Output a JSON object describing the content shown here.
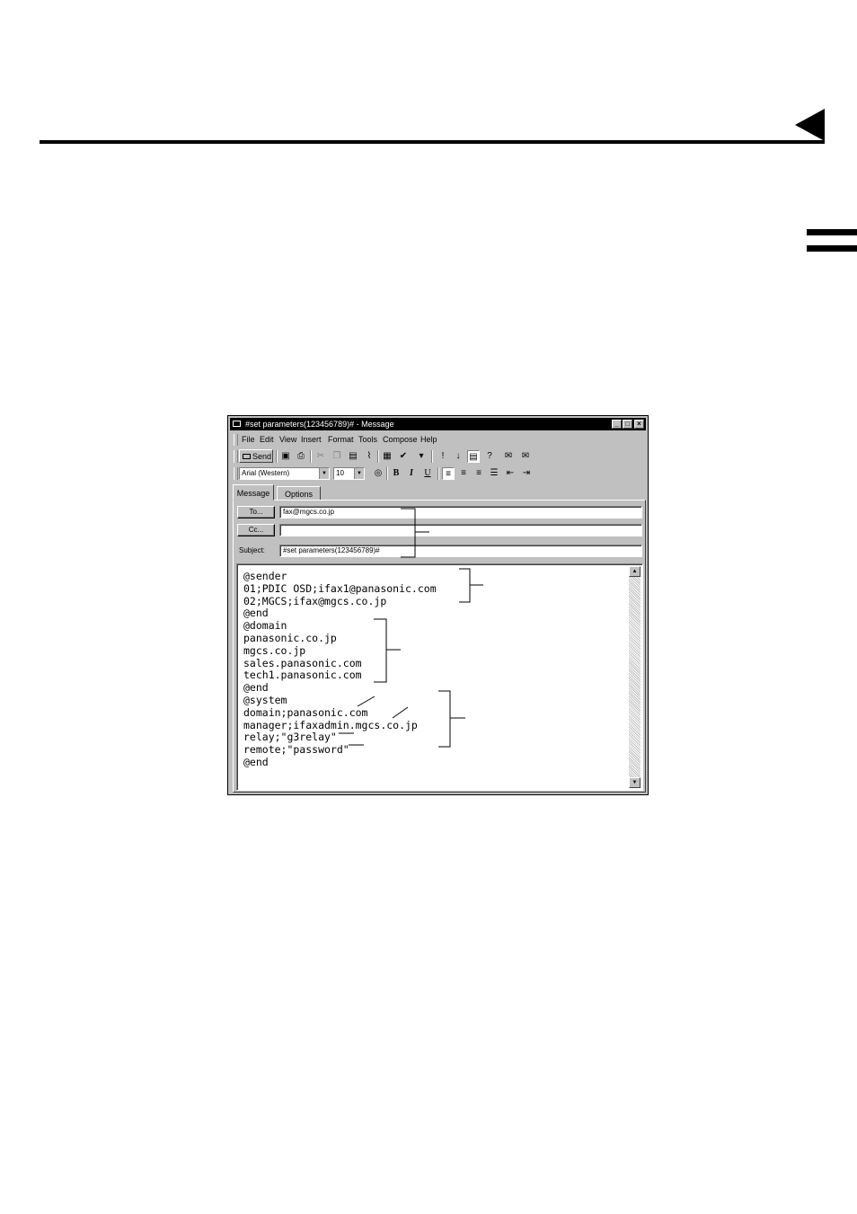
{
  "window": {
    "title": "#set parameters(123456789)# - Message",
    "controls": {
      "minimize": "_",
      "maximize": "□",
      "close": "×"
    }
  },
  "menubar": {
    "items": [
      "File",
      "Edit",
      "View",
      "Insert",
      "Format",
      "Tools",
      "Compose",
      "Help"
    ]
  },
  "toolbar": {
    "send_label": "Send"
  },
  "format_bar": {
    "font": "Arial (Western)",
    "size": "10",
    "bold": "B",
    "italic": "I",
    "underline": "U"
  },
  "tabs": [
    "Message",
    "Options"
  ],
  "header": {
    "to_button": "To...",
    "cc_button": "Cc...",
    "subject_label": "Subject:",
    "to_value": "fax@mgcs.co.jp",
    "cc_value": "",
    "subject_value": "#set parameters(123456789)#"
  },
  "body": {
    "lines": [
      "@sender",
      "01;PDIC OSD;ifax1@panasonic.com",
      "02;MGCS;ifax@mgcs.co.jp",
      "@end",
      "@domain",
      "panasonic.co.jp",
      "mgcs.co.jp",
      "sales.panasonic.com",
      "tech1.panasonic.com",
      "@end",
      "@system",
      "domain;panasonic.com",
      "manager;ifaxadmin.mgcs.co.jp",
      "relay;\"g3relay\"",
      "remote;\"password\"",
      "@end"
    ]
  },
  "icons": {
    "window": "envelope-icon",
    "save": "save-icon",
    "print": "print-icon",
    "cut": "cut-icon",
    "copy": "copy-icon",
    "paste": "paste-icon",
    "attach": "paperclip-icon"
  }
}
